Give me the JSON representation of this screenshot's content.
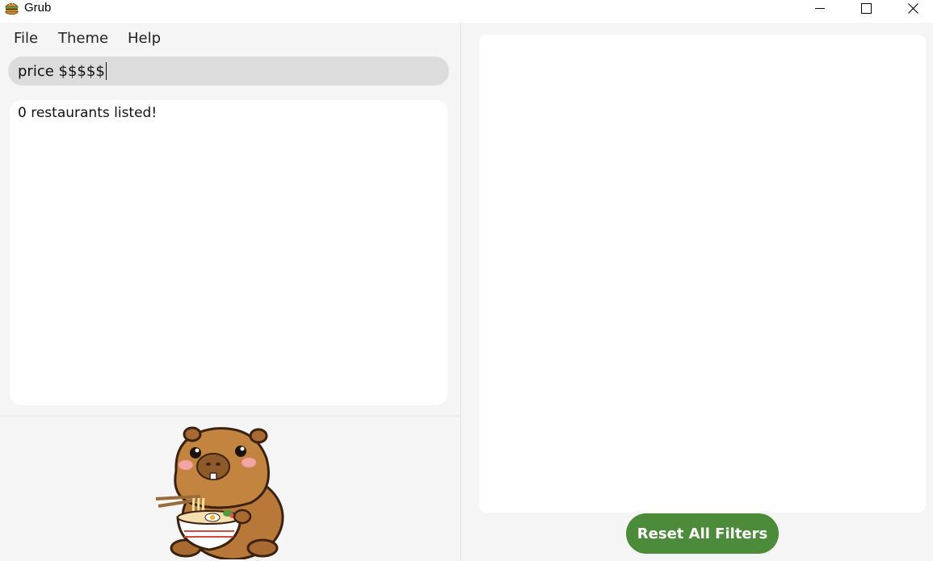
{
  "window": {
    "title": "Grub",
    "app_icon": "burger-icon",
    "controls": {
      "minimize_icon": "minimize-icon",
      "maximize_icon": "maximize-icon",
      "close_icon": "close-icon"
    }
  },
  "menu": {
    "file": "File",
    "theme": "Theme",
    "help": "Help"
  },
  "command": {
    "value": "price $$$$$"
  },
  "results": {
    "message": "0 restaurants listed!"
  },
  "mascot": {
    "icon": "capybara-eating-ramen-icon"
  },
  "actions": {
    "reset_label": "Reset All Filters"
  },
  "colors": {
    "accent": "#4c8b3a",
    "background": "#f5f5f5",
    "command_box": "#dcdcdc",
    "panel": "#ffffff"
  }
}
